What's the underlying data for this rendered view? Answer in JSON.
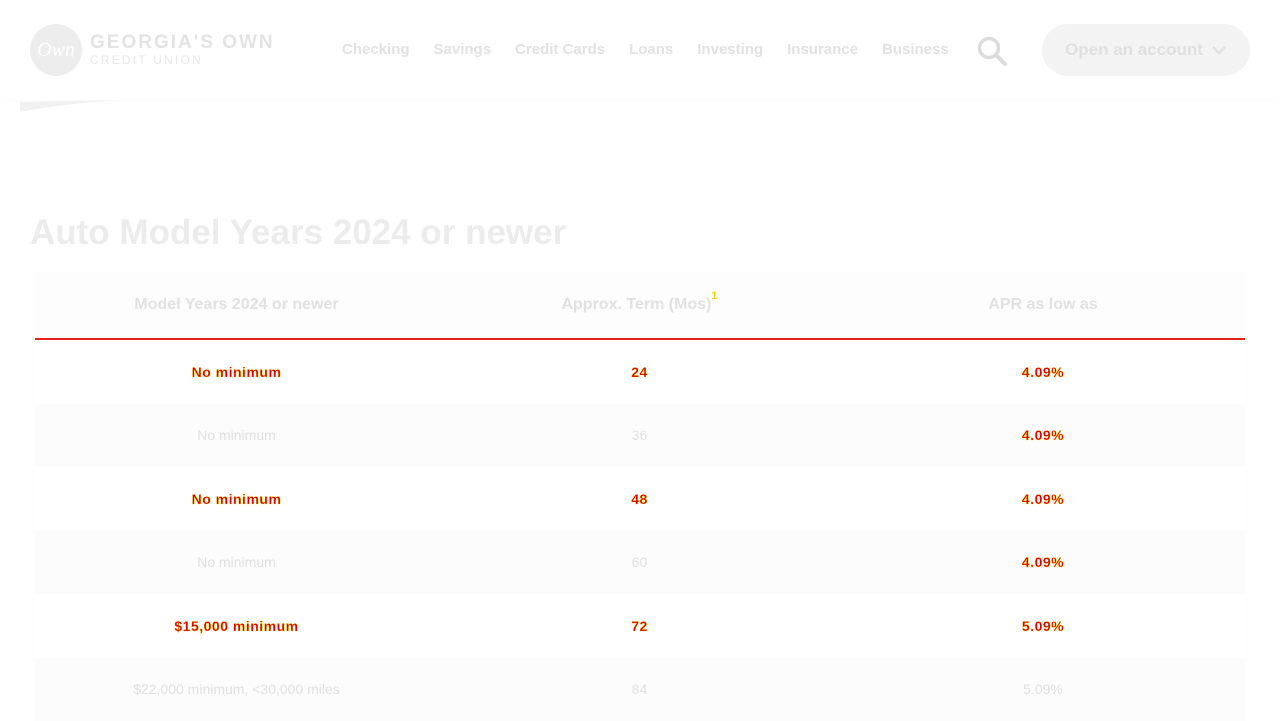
{
  "header": {
    "logo": {
      "mark": "Own",
      "name": "GEORGIA'S OWN",
      "sub": "CREDIT UNION"
    },
    "nav": [
      "Checking",
      "Savings",
      "Credit Cards",
      "Loans",
      "Investing",
      "Insurance",
      "Business"
    ],
    "search_icon": "search-icon",
    "open_account_label": "Open an account",
    "open_account_icon": "chevron-down-icon"
  },
  "main": {
    "heading": "Auto Model Years 2024 or newer",
    "table": {
      "headers": [
        "Model Years 2024 or newer",
        "Approx. Term (Mos)",
        "APR as low as"
      ],
      "term_footnote": "1",
      "rows": [
        {
          "min": "No minimum",
          "term": "24",
          "apr": "4.09%"
        },
        {
          "min": "No minimum",
          "term": "36",
          "apr": "4.09%"
        },
        {
          "min": "No minimum",
          "term": "48",
          "apr": "4.09%"
        },
        {
          "min": "No minimum",
          "term": "60",
          "apr": "4.09%"
        },
        {
          "min": "$15,000 minimum",
          "term": "72",
          "apr": "5.09%"
        },
        {
          "min": "$22,000 minimum, <30,000 miles",
          "term": "84",
          "apr": "5.09%"
        }
      ]
    }
  },
  "colors": {
    "accent": "#e2231a",
    "highlight": "#f2d400"
  }
}
